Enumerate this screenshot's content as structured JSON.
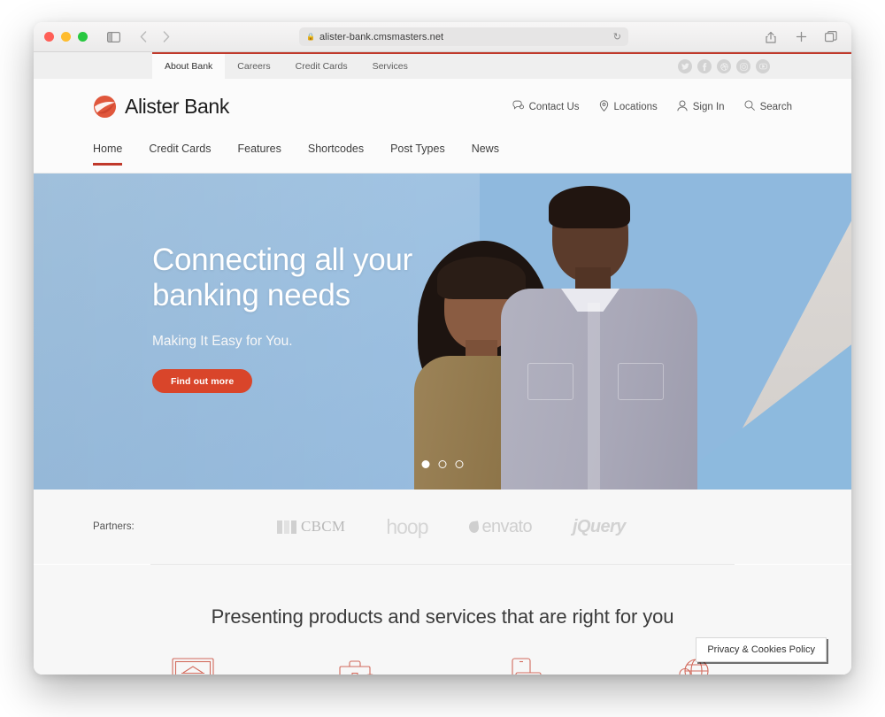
{
  "browser": {
    "name": "safari",
    "url": "alister-bank.cmsmasters.net",
    "lock_icon": "lock-icon",
    "reload_icon": "reload-icon",
    "sidebar_icon": "sidebar-icon",
    "back_icon": "back-arrow-icon",
    "forward_icon": "forward-arrow-icon",
    "reader_icon": "reader-view-icon",
    "share_icon": "share-icon",
    "new_tab_icon": "plus-icon",
    "tab_overview_icon": "tab-overview-icon"
  },
  "site": {
    "topbar": {
      "accent_color": "#c0392b",
      "items": [
        {
          "label": "About Bank",
          "active": true
        },
        {
          "label": "Careers",
          "active": false
        },
        {
          "label": "Credit Cards",
          "active": false
        },
        {
          "label": "Services",
          "active": false
        }
      ],
      "social": [
        {
          "name": "twitter-icon",
          "glyph": "❧"
        },
        {
          "name": "facebook-icon",
          "glyph": "f"
        },
        {
          "name": "dribbble-icon",
          "glyph": "●"
        },
        {
          "name": "instagram-icon",
          "glyph": "▣"
        },
        {
          "name": "youtube-icon",
          "glyph": "▶"
        }
      ]
    },
    "header": {
      "logo_text": "Alister Bank",
      "logo_color": "#d9452a",
      "utility": [
        {
          "label": "Contact Us",
          "icon": "chat-icon"
        },
        {
          "label": "Locations",
          "icon": "map-pin-icon"
        },
        {
          "label": "Sign In",
          "icon": "user-icon"
        },
        {
          "label": "Search",
          "icon": "search-icon"
        }
      ],
      "nav": [
        {
          "label": "Home",
          "active": true
        },
        {
          "label": "Credit Cards",
          "active": false
        },
        {
          "label": "Features",
          "active": false
        },
        {
          "label": "Shortcodes",
          "active": false
        },
        {
          "label": "Post Types",
          "active": false
        },
        {
          "label": "News",
          "active": false
        }
      ]
    },
    "hero": {
      "title_line1": "Connecting all your",
      "title_line2": "banking needs",
      "subtitle": "Making It Easy for You.",
      "cta_label": "Find out more",
      "cta_color": "#d9452a",
      "slides": 3,
      "active_slide": 1
    },
    "partners": {
      "label": "Partners:",
      "logos": [
        {
          "name": "cbcm-logo",
          "text": "CBCM"
        },
        {
          "name": "hoop-logo",
          "text": "hoop"
        },
        {
          "name": "envato-logo",
          "text": "envato"
        },
        {
          "name": "jquery-logo",
          "text": "jQuery"
        }
      ]
    },
    "products": {
      "title": "Presenting products and services that are right for you",
      "icon_color": "#d26a5c",
      "icons": [
        {
          "name": "bank-on-monitor-icon"
        },
        {
          "name": "briefcase-chart-icon"
        },
        {
          "name": "mobile-card-payment-icon"
        },
        {
          "name": "lock-globe-security-icon"
        }
      ]
    },
    "cookie_notice": {
      "label": "Privacy & Cookies Policy"
    }
  }
}
